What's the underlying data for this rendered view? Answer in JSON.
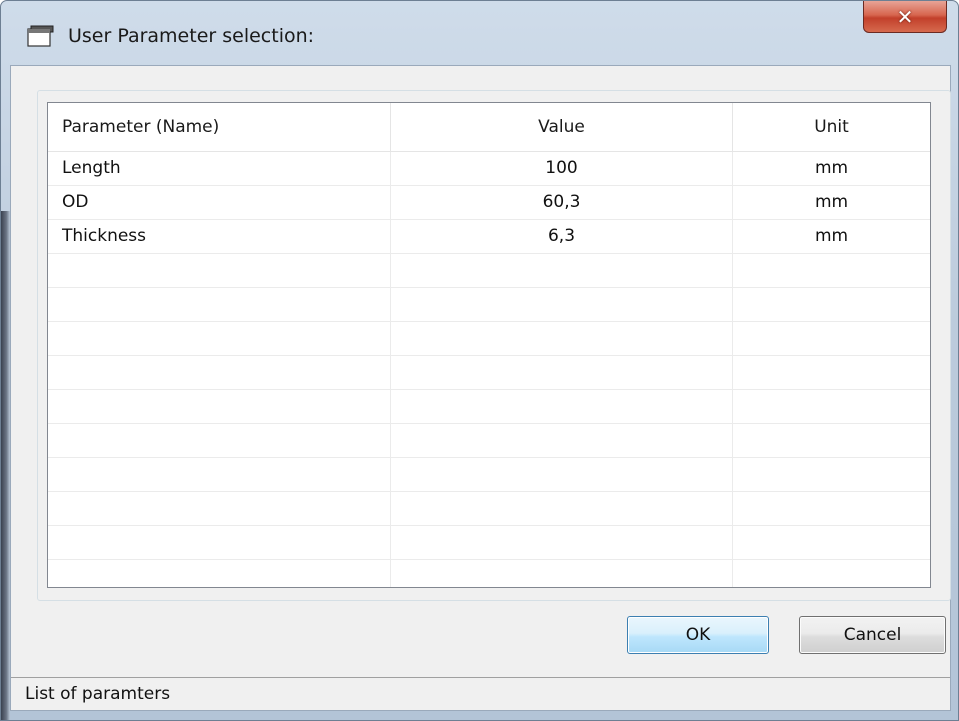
{
  "window": {
    "title": "User Parameter selection:",
    "close_symbol": "✕",
    "app_icon": "window-app-icon"
  },
  "table": {
    "headers": [
      "Parameter (Name)",
      "Value",
      "Unit"
    ],
    "rows": [
      {
        "name": "Length",
        "value": "100",
        "unit": "mm"
      },
      {
        "name": "OD",
        "value": "60,3",
        "unit": "mm"
      },
      {
        "name": "Thickness",
        "value": "6,3",
        "unit": "mm"
      }
    ],
    "empty_row_count": 10
  },
  "buttons": {
    "ok_label": "OK",
    "cancel_label": "Cancel"
  },
  "status_bar": {
    "text": "List of paramters"
  },
  "colors": {
    "titlebar": "#c3d2e3",
    "close_button": "#c7442d",
    "ok_button_border": "#3c7fb1",
    "client_background": "#f0f0f0"
  }
}
